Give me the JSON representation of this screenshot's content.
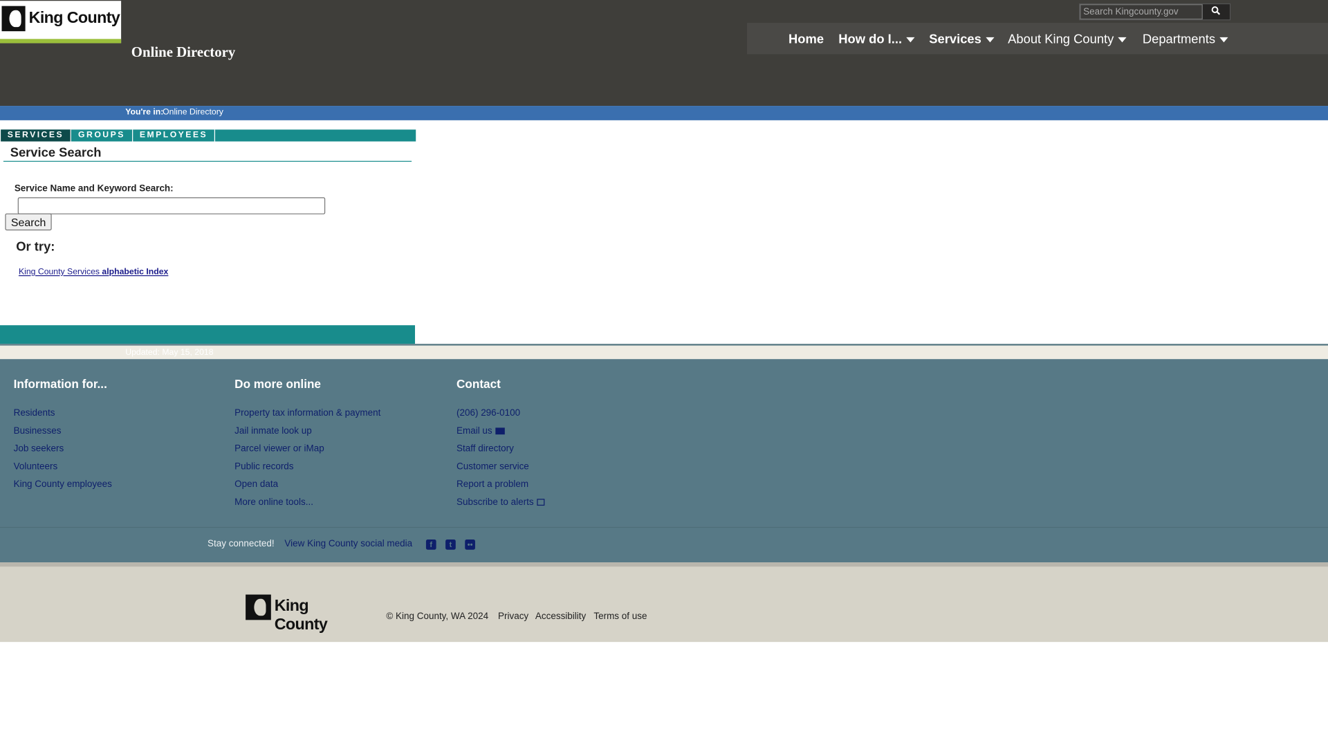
{
  "header": {
    "logo_text": "King County",
    "site_title": "Online Directory",
    "search_placeholder": "Search Kingcounty.gov",
    "search_icon": "magnifier-icon",
    "nav": [
      {
        "label": "Home"
      },
      {
        "label": "How do I..."
      },
      {
        "label": "Services"
      },
      {
        "label": "About King County"
      },
      {
        "label": "Departments"
      }
    ]
  },
  "breadcrumb": {
    "label": "You're in:",
    "value": "Online Directory"
  },
  "tabs": [
    {
      "label": "SERVICES"
    },
    {
      "label": "GROUPS"
    },
    {
      "label": "EMPLOYEES"
    }
  ],
  "main": {
    "section_title": "Service Search",
    "keyword_label": "Service Name and Keyword Search:",
    "keyword_value": "",
    "search_button": "Search",
    "or_try": "Or try:",
    "index_link_prefix": "King County Services",
    "index_link_bold": "alphabetic Index",
    "updated": "Updated: May 15, 2018"
  },
  "footer": {
    "col1_title": "Information for...",
    "col1": [
      "Residents",
      "Businesses",
      "Job seekers",
      "Volunteers",
      "King County employees"
    ],
    "col2_title": "Do more online",
    "col2": [
      "Property tax information & payment",
      "Jail inmate look up",
      "Parcel viewer or iMap",
      "Public records",
      "Open data",
      "More online tools..."
    ],
    "col3_title": "Contact",
    "col3": [
      "(206) 296-0100",
      "Email us",
      "Staff directory",
      "Customer service",
      "Report a problem",
      "Subscribe to alerts"
    ],
    "stay_connected": "Stay connected!",
    "social_link": "View King County social media",
    "social_icons": [
      "facebook-icon",
      "twitter-icon",
      "flickr-icon"
    ]
  },
  "bottom": {
    "logo_text": "King County",
    "copyright": "© King County, WA 2024",
    "links": [
      "Privacy",
      "Accessibility",
      "Terms of use"
    ]
  }
}
